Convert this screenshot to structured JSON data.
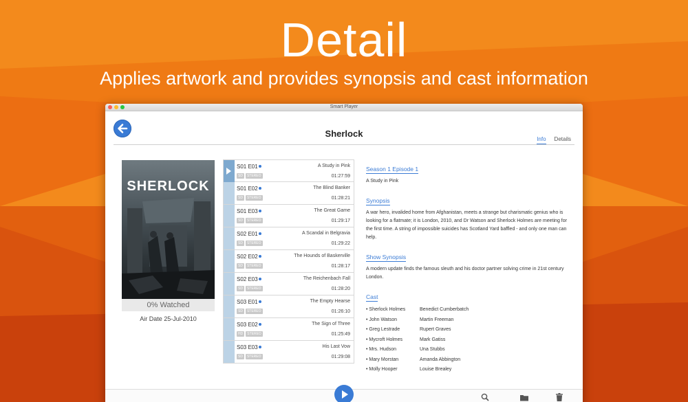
{
  "hero": {
    "title": "Detail",
    "subtitle": "Applies artwork and provides synopsis and cast information"
  },
  "window": {
    "title": "Smart Player",
    "show_title": "Sherlock",
    "tabs": [
      {
        "label": "Info",
        "active": true
      },
      {
        "label": "Details",
        "active": false
      }
    ]
  },
  "poster": {
    "text": "SHERLOCK",
    "watched": "0% Watched",
    "air_date": "Air Date 25-Jul-2010"
  },
  "episodes": [
    {
      "code": "S01 E01",
      "title": "A Study in Pink",
      "duration": "01:27:59",
      "quality": "SD",
      "audio": "STEREO",
      "selected": true
    },
    {
      "code": "S01 E02",
      "title": "The Blind Banker",
      "duration": "01:28:21",
      "quality": "SD",
      "audio": "STEREO"
    },
    {
      "code": "S01 E03",
      "title": "The Great Game",
      "duration": "01:29:17",
      "quality": "SD",
      "audio": "STEREO"
    },
    {
      "code": "S02 E01",
      "title": "A Scandal in Belgravia",
      "duration": "01:29:22",
      "quality": "SD",
      "audio": "STEREO"
    },
    {
      "code": "S02 E02",
      "title": "The Hounds of Baskerville",
      "duration": "01:28:17",
      "quality": "SD",
      "audio": "STEREO"
    },
    {
      "code": "S02 E03",
      "title": "The Reichenbach Fall",
      "duration": "01:28:20",
      "quality": "SD",
      "audio": "STEREO"
    },
    {
      "code": "S03 E01",
      "title": "The Empty Hearse",
      "duration": "01:26:10",
      "quality": "SD",
      "audio": "STEREO"
    },
    {
      "code": "S03 E02",
      "title": "The Sign of Three",
      "duration": "01:25:49",
      "quality": "HD",
      "audio": "STEREO"
    },
    {
      "code": "S03 E03",
      "title": "His Last Vow",
      "duration": "01:29:08",
      "quality": "SD",
      "audio": "STEREO"
    }
  ],
  "info": {
    "episode_heading": "Season 1 Episode 1",
    "episode_name": "A Study in Pink",
    "synopsis_heading": "Synopsis",
    "synopsis": "A war hero, invalided home from Afghanistan, meets a strange but charismatic genius who is looking for a flatmate; it is London, 2010, and Dr Watson and Sherlock Holmes are meeting for the first time. A string of impossible suicides has Scotland Yard baffled - and only one man can help.",
    "show_synopsis_heading": "Show Synopsis",
    "show_synopsis": "A modern update finds the famous sleuth and his doctor partner solving crime in 21st century London.",
    "cast_heading": "Cast",
    "cast": [
      {
        "role": "• Sherlock Holmes",
        "actor": "Benedict Cumberbatch"
      },
      {
        "role": "• John Watson",
        "actor": "Martin Freeman"
      },
      {
        "role": "• Greg Lestrade",
        "actor": "Rupert Graves"
      },
      {
        "role": "• Mycroft Holmes",
        "actor": "Mark Gatiss"
      },
      {
        "role": "• Mrs. Hudson",
        "actor": "Una Stubbs"
      },
      {
        "role": "• Mary Morstan",
        "actor": "Amanda Abbington"
      },
      {
        "role": "• Molly Hooper",
        "actor": "Louise Brealey"
      }
    ]
  },
  "toolbar": {
    "icons": [
      "play-icon",
      "search-icon",
      "folder-icon",
      "trash-icon"
    ]
  },
  "colors": {
    "accent": "#3a7bd5",
    "background": "#f07a12"
  }
}
